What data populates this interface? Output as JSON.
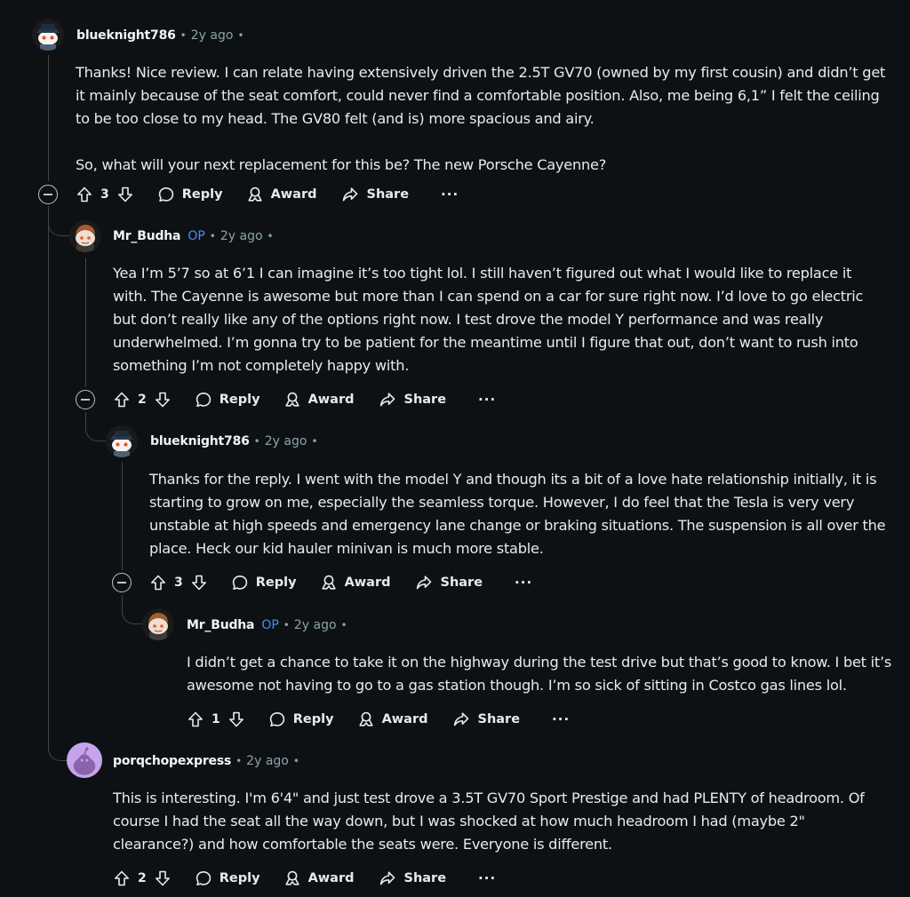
{
  "comments": [
    {
      "username": "blueknight786",
      "op": "",
      "time": "2y ago",
      "paragraphs": [
        "Thanks! Nice review. I can relate having extensively driven the 2.5T GV70 (owned by my first cousin) and didn’t get it mainly because of the seat comfort, could never find a comfortable position. Also, me being 6,1” I felt the ceiling to be too close to my head. The GV80 felt (and is) more spacious and airy.",
        "So, what will your next replacement for this be? The new Porsche Cayenne?"
      ],
      "score": "3",
      "reply": "Reply",
      "award": "Award",
      "share": "Share",
      "more": "···"
    },
    {
      "username": "Mr_Budha",
      "op": "OP",
      "time": "2y ago",
      "paragraphs": [
        "Yea I’m 5’7 so at 6’1 I can imagine it’s too tight lol. I still haven’t figured out what I would like to replace it with. The Cayenne is awesome but more than I can spend on a car for sure right now. I’d love to go electric but don’t really like any of the options right now. I test drove the model Y performance and was really underwhelmed. I’m gonna try to be patient for the meantime until I figure that out, don’t want to rush into something I’m not completely happy with."
      ],
      "score": "2",
      "reply": "Reply",
      "award": "Award",
      "share": "Share",
      "more": "···"
    },
    {
      "username": "blueknight786",
      "op": "",
      "time": "2y ago",
      "paragraphs": [
        "Thanks for the reply. I went with the model Y and though its a bit of a love hate relationship initially, it is starting to grow on me, especially the seamless torque. However, I do feel that the Tesla is very very unstable at high speeds and emergency lane change or braking situations. The suspension is all over the place. Heck our kid hauler minivan is much more stable."
      ],
      "score": "3",
      "reply": "Reply",
      "award": "Award",
      "share": "Share",
      "more": "···"
    },
    {
      "username": "Mr_Budha",
      "op": "OP",
      "time": "2y ago",
      "paragraphs": [
        "I didn’t get a chance to take it on the highway during the test drive but that’s good to know. I bet it’s awesome not having to go to a gas station though. I’m so sick of sitting in Costco gas lines lol."
      ],
      "score": "1",
      "reply": "Reply",
      "award": "Award",
      "share": "Share",
      "more": "···"
    },
    {
      "username": "porqchopexpress",
      "op": "",
      "time": "2y ago",
      "paragraphs": [
        "This is interesting. I'm 6'4\" and just test drove a 3.5T GV70 Sport Prestige and had PLENTY of headroom. Of course I had the seat all the way down, but I was shocked at how much headroom I had (maybe 2\" clearance?) and how comfortable the seats were. Everyone is different."
      ],
      "score": "2",
      "reply": "Reply",
      "award": "Award",
      "share": "Share",
      "more": "···"
    }
  ],
  "icons": {
    "collapse": "collapse-circle-minus-icon",
    "upvote": "upvote-arrow-icon",
    "downvote": "downvote-arrow-icon",
    "reply": "reply-bubble-icon",
    "award": "award-ribbon-icon",
    "share": "share-arrow-icon"
  },
  "colors": {
    "background": "#0e1113",
    "op_badge": "#4b8cf7",
    "meta": "#8ba2ad",
    "thread_line": "#3e4447"
  }
}
